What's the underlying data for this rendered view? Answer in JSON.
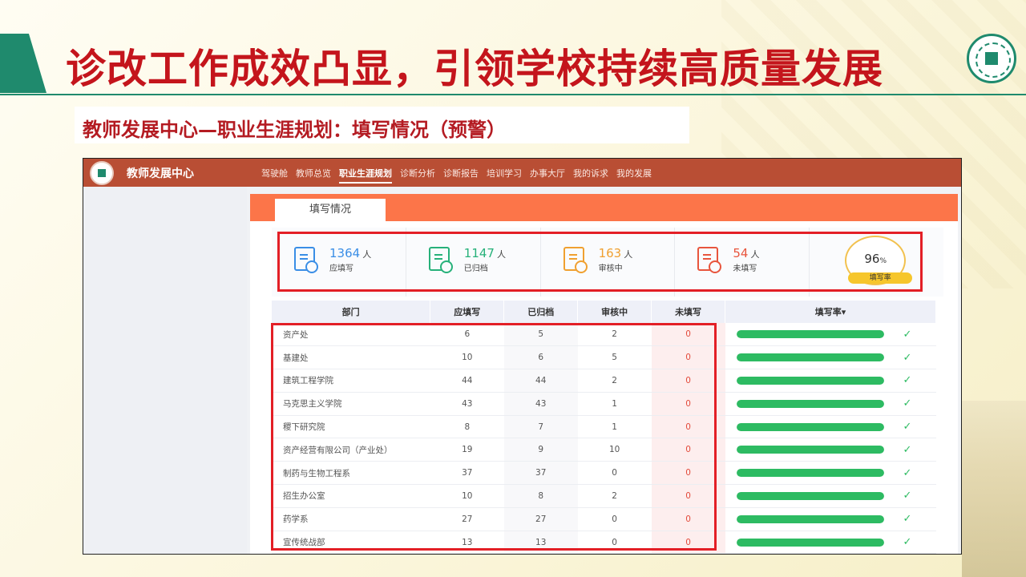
{
  "slide": {
    "title": "诊改工作成效凸显，引领学校持续高质量发展",
    "subtitle": "教师发展中心—职业生涯规划：填写情况（预警）"
  },
  "app": {
    "brand": "教师发展中心",
    "nav": [
      "驾驶舱",
      "教师总览",
      "职业生涯规划",
      "诊断分析",
      "诊断报告",
      "培训学习",
      "办事大厅",
      "我的诉求",
      "我的发展"
    ],
    "active_nav": "职业生涯规划",
    "tab": "填写情况"
  },
  "stats": [
    {
      "value": "1364",
      "unit": "人",
      "label": "应填写",
      "color": "#3a8ee6",
      "icon": "form-icon"
    },
    {
      "value": "1147",
      "unit": "人",
      "label": "已归档",
      "color": "#27b17a",
      "icon": "archive-check-icon"
    },
    {
      "value": "163",
      "unit": "人",
      "label": "审核中",
      "color": "#f0a030",
      "icon": "review-search-icon"
    },
    {
      "value": "54",
      "unit": "人",
      "label": "未填写",
      "color": "#e8553d",
      "icon": "form-x-icon"
    }
  ],
  "rate": {
    "value": "96",
    "unit": "%",
    "label": "填写率"
  },
  "table": {
    "headers": [
      "部门",
      "应填写",
      "已归档",
      "审核中",
      "未填写",
      "填写率▾"
    ],
    "rows": [
      {
        "dept": "资产处",
        "total": "6",
        "archived": "5",
        "reviewing": "2",
        "missing": "0",
        "rate": 1.0
      },
      {
        "dept": "基建处",
        "total": "10",
        "archived": "6",
        "reviewing": "5",
        "missing": "0",
        "rate": 1.0
      },
      {
        "dept": "建筑工程学院",
        "total": "44",
        "archived": "44",
        "reviewing": "2",
        "missing": "0",
        "rate": 1.0
      },
      {
        "dept": "马克思主义学院",
        "total": "43",
        "archived": "43",
        "reviewing": "1",
        "missing": "0",
        "rate": 1.0
      },
      {
        "dept": "稷下研究院",
        "total": "8",
        "archived": "7",
        "reviewing": "1",
        "missing": "0",
        "rate": 1.0
      },
      {
        "dept": "资产经营有限公司（产业处）",
        "total": "19",
        "archived": "9",
        "reviewing": "10",
        "missing": "0",
        "rate": 1.0
      },
      {
        "dept": "制药与生物工程系",
        "total": "37",
        "archived": "37",
        "reviewing": "0",
        "missing": "0",
        "rate": 1.0
      },
      {
        "dept": "招生办公室",
        "total": "10",
        "archived": "8",
        "reviewing": "2",
        "missing": "0",
        "rate": 1.0
      },
      {
        "dept": "药学系",
        "total": "27",
        "archived": "27",
        "reviewing": "0",
        "missing": "0",
        "rate": 1.0
      },
      {
        "dept": "宣传统战部",
        "total": "13",
        "archived": "13",
        "reviewing": "0",
        "missing": "0",
        "rate": 1.0
      }
    ]
  }
}
